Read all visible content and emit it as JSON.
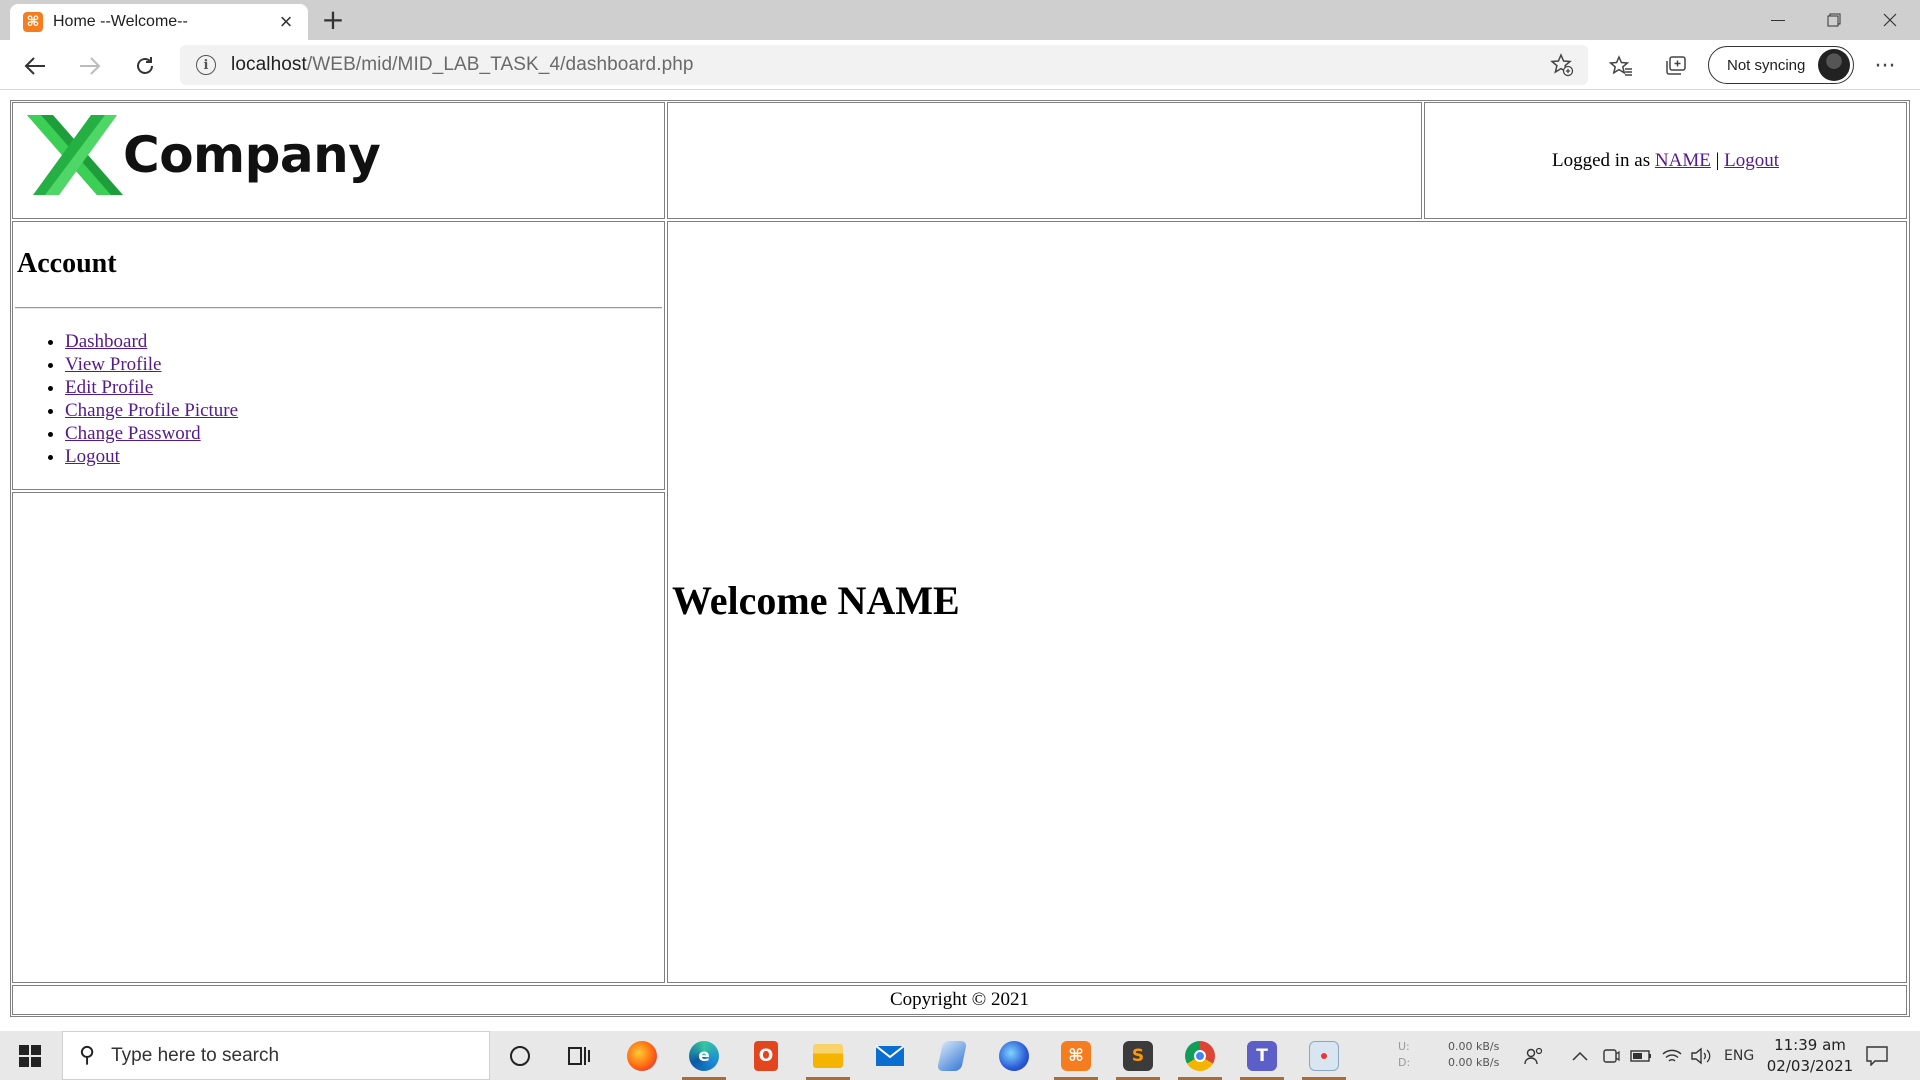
{
  "browser": {
    "tab_title": "Home --Welcome--",
    "tab_favicon": "xampp-icon",
    "url_host": "localhost",
    "url_path": "/WEB/mid/MID_LAB_TASK_4/dashboard.php",
    "sync_label": "Not syncing"
  },
  "header": {
    "logo_text": "Company",
    "logged_in_prefix": "Logged in as",
    "user_name": "NAME",
    "separator": "|",
    "logout_label": "Logout"
  },
  "sidebar": {
    "title": "Account",
    "items": [
      {
        "label": "Dashboard"
      },
      {
        "label": "View Profile"
      },
      {
        "label": "Edit Profile"
      },
      {
        "label": "Change Profile Picture"
      },
      {
        "label": "Change Password"
      },
      {
        "label": "Logout"
      }
    ]
  },
  "main": {
    "welcome_text": "Welcome NAME"
  },
  "footer": {
    "copyright": "Copyright © 2021"
  },
  "taskbar": {
    "search_placeholder": "Type here to search",
    "net_up_label": "U:",
    "net_up": "0.00 kB/s",
    "net_down_label": "D:",
    "net_down": "0.00 kB/s",
    "language": "ENG",
    "time": "11:39 am",
    "date": "02/03/2021",
    "apps": [
      {
        "name": "firefox",
        "color": "#e66000"
      },
      {
        "name": "edge",
        "color": "#1a8ad6"
      },
      {
        "name": "office",
        "color": "#e2461e"
      },
      {
        "name": "file-explorer",
        "color": "#f4b400"
      },
      {
        "name": "mail",
        "color": "#0a6ed1"
      },
      {
        "name": "stack",
        "color": "#3a7bd5"
      },
      {
        "name": "firefox-blue",
        "color": "#2a5bd7"
      },
      {
        "name": "xampp",
        "color": "#f57c1f"
      },
      {
        "name": "sublime",
        "color": "#3b3b3b"
      },
      {
        "name": "chrome",
        "color": "#db4437"
      },
      {
        "name": "teams",
        "color": "#5b5fc7"
      },
      {
        "name": "snipping",
        "color": "#d9e6f2"
      }
    ]
  },
  "colors": {
    "link": "#551a8b",
    "border": "#808080",
    "logo_green": "#2dbb3f"
  }
}
